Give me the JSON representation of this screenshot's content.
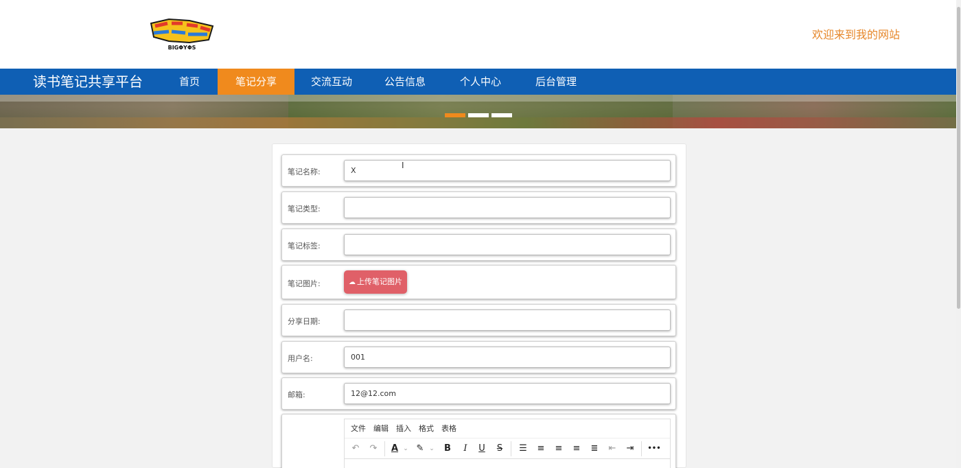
{
  "header": {
    "logo_text": "BIGΦYΦS",
    "welcome": "欢迎来到我的网站"
  },
  "nav": {
    "brand": "读书笔记共享平台",
    "items": [
      {
        "label": "首页"
      },
      {
        "label": "笔记分享"
      },
      {
        "label": "交流互动"
      },
      {
        "label": "公告信息"
      },
      {
        "label": "个人中心"
      },
      {
        "label": "后台管理"
      }
    ],
    "active_index": 1
  },
  "banner": {
    "slide_count": 3,
    "active_slide": 0
  },
  "form": {
    "name": {
      "label": "笔记名称:",
      "value": "X"
    },
    "type": {
      "label": "笔记类型:",
      "value": ""
    },
    "tags": {
      "label": "笔记标签:",
      "value": ""
    },
    "image": {
      "label": "笔记图片:",
      "button": "上传笔记图片"
    },
    "date": {
      "label": "分享日期:",
      "value": ""
    },
    "username": {
      "label": "用户名:",
      "value": "001"
    },
    "email": {
      "label": "邮箱:",
      "value": "12@12.com"
    }
  },
  "editor": {
    "menu": [
      "文件",
      "编辑",
      "插入",
      "格式",
      "表格"
    ],
    "tools": {
      "undo": "↶",
      "redo": "↷",
      "font_color": "A",
      "highlight": "✎",
      "bold": "B",
      "italic": "I",
      "underline": "U",
      "strike": "S",
      "more": "•••"
    }
  },
  "colors": {
    "nav_bg": "#0f5fb4",
    "nav_active": "#f08a1d",
    "welcome_text": "#e6872a",
    "upload_button": "#e06068"
  }
}
